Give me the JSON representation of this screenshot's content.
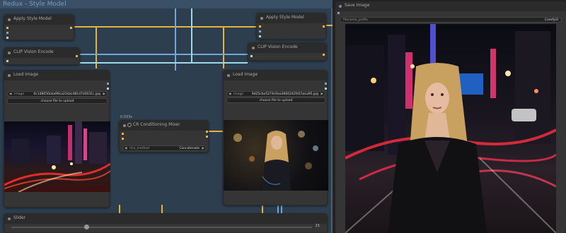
{
  "group": {
    "title": "Redux - Style Model"
  },
  "nodes": {
    "apply_style_1": {
      "title": "Apply Style Model"
    },
    "clip_vision_1": {
      "title": "CLIP Vision Encode"
    },
    "load_image_1": {
      "title": "Load Image",
      "image_label": "image",
      "image_value": "0c148050cba99ca23cbc481d7d3031c.jpg",
      "upload_label": "choose file to upload"
    },
    "cr_mixer": {
      "title": "CR Conditioning Mixer",
      "timing": "0.033s",
      "mix_label": "mix_method",
      "mix_value": "Concatenate"
    },
    "apply_style_2": {
      "title": "Apply Style Model"
    },
    "clip_vision_2": {
      "title": "CLIP Vision Encode"
    },
    "load_image_2": {
      "title": "Load Image",
      "image_label": "image",
      "image_value": "9d25cbe5274c0ea3660242fd15aca95.jpg",
      "upload_label": "choose file to upload"
    },
    "slider": {
      "title": "Slider",
      "value": "21",
      "level": 0.25
    },
    "save_image": {
      "title": "Save Image",
      "prefix_label": "filename_prefix",
      "prefix_value": "ComfyUI"
    }
  },
  "colors": {
    "wire_yellow": "#e8b33a",
    "wire_blue": "#6fa8dc",
    "wire_cyan": "#9fd8e8",
    "group_bg": "#2d3f4f",
    "node_bg": "#353535"
  }
}
